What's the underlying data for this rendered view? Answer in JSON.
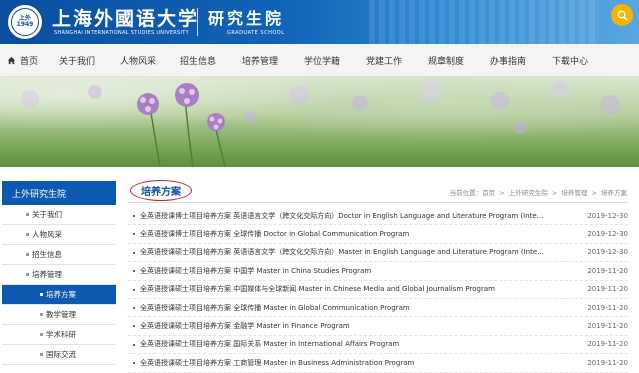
{
  "header": {
    "logo_text_top": "上外",
    "logo_text_bottom": "1949",
    "university_cn": "上海外國语大学",
    "university_en": "SHANGHAI INTERNATIONAL STUDIES UNIVERSITY",
    "school_cn": "研究生院",
    "school_en": "GRADUATE SCHOOL",
    "search_icon": "search-icon",
    "brand_color": "#0e59b0",
    "search_color": "#f5b400"
  },
  "nav": {
    "items": [
      {
        "label": "首页",
        "icon": "home-icon"
      },
      {
        "label": "关于我们"
      },
      {
        "label": "人物风采"
      },
      {
        "label": "招生信息"
      },
      {
        "label": "培养管理"
      },
      {
        "label": "学位学籍"
      },
      {
        "label": "党建工作"
      },
      {
        "label": "规章制度"
      },
      {
        "label": "办事指南"
      },
      {
        "label": "下载中心"
      }
    ]
  },
  "sidebar": {
    "title": "上外研究生院",
    "items": [
      {
        "label": "关于我们"
      },
      {
        "label": "人物风采"
      },
      {
        "label": "招生信息"
      },
      {
        "label": "培养管理"
      },
      {
        "label": "培养方案",
        "active": true
      },
      {
        "label": "教学管理"
      },
      {
        "label": "学术科研"
      },
      {
        "label": "国际交流"
      }
    ]
  },
  "main": {
    "title": "培养方案",
    "breadcrumb": [
      "当前位置：首页",
      ">",
      "上外研究生院",
      ">",
      "培养管理",
      ">",
      "培养方案"
    ],
    "rows": [
      {
        "title": "全英语授课博士项目培养方案 英语语言文学（跨文化交际方向）Doctor in English Language and Literature Program (Inte...",
        "date": "2019-12-30"
      },
      {
        "title": "全英语授课博士项目培养方案 全球传播 Doctor in Global Communication Program",
        "date": "2019-12-30"
      },
      {
        "title": "全英语授课硕士项目培养方案 英语语言文学（跨文化交际方向）Master in English Language and Literature Program (Inte...",
        "date": "2019-12-30"
      },
      {
        "title": "全英语授课硕士项目培养方案 中国学 Master in China Studies Program",
        "date": "2019-11-20"
      },
      {
        "title": "全英语授课硕士项目培养方案 中国媒体与全球新闻 Master in Chinese Media and Global Journalism Program",
        "date": "2019-11-20"
      },
      {
        "title": "全英语授课硕士项目培养方案 全球传播 Master in Global Communication Program",
        "date": "2019-11-20"
      },
      {
        "title": "全英语授课硕士项目培养方案 金融学 Master in Finance Program",
        "date": "2019-11-20"
      },
      {
        "title": "全英语授课硕士项目培养方案 国际关系 Master in International Affairs Program",
        "date": "2019-11-20"
      },
      {
        "title": "全英语授课硕士项目培养方案 工商管理 Master in Business Administration Program",
        "date": "2019-11-20"
      }
    ]
  }
}
